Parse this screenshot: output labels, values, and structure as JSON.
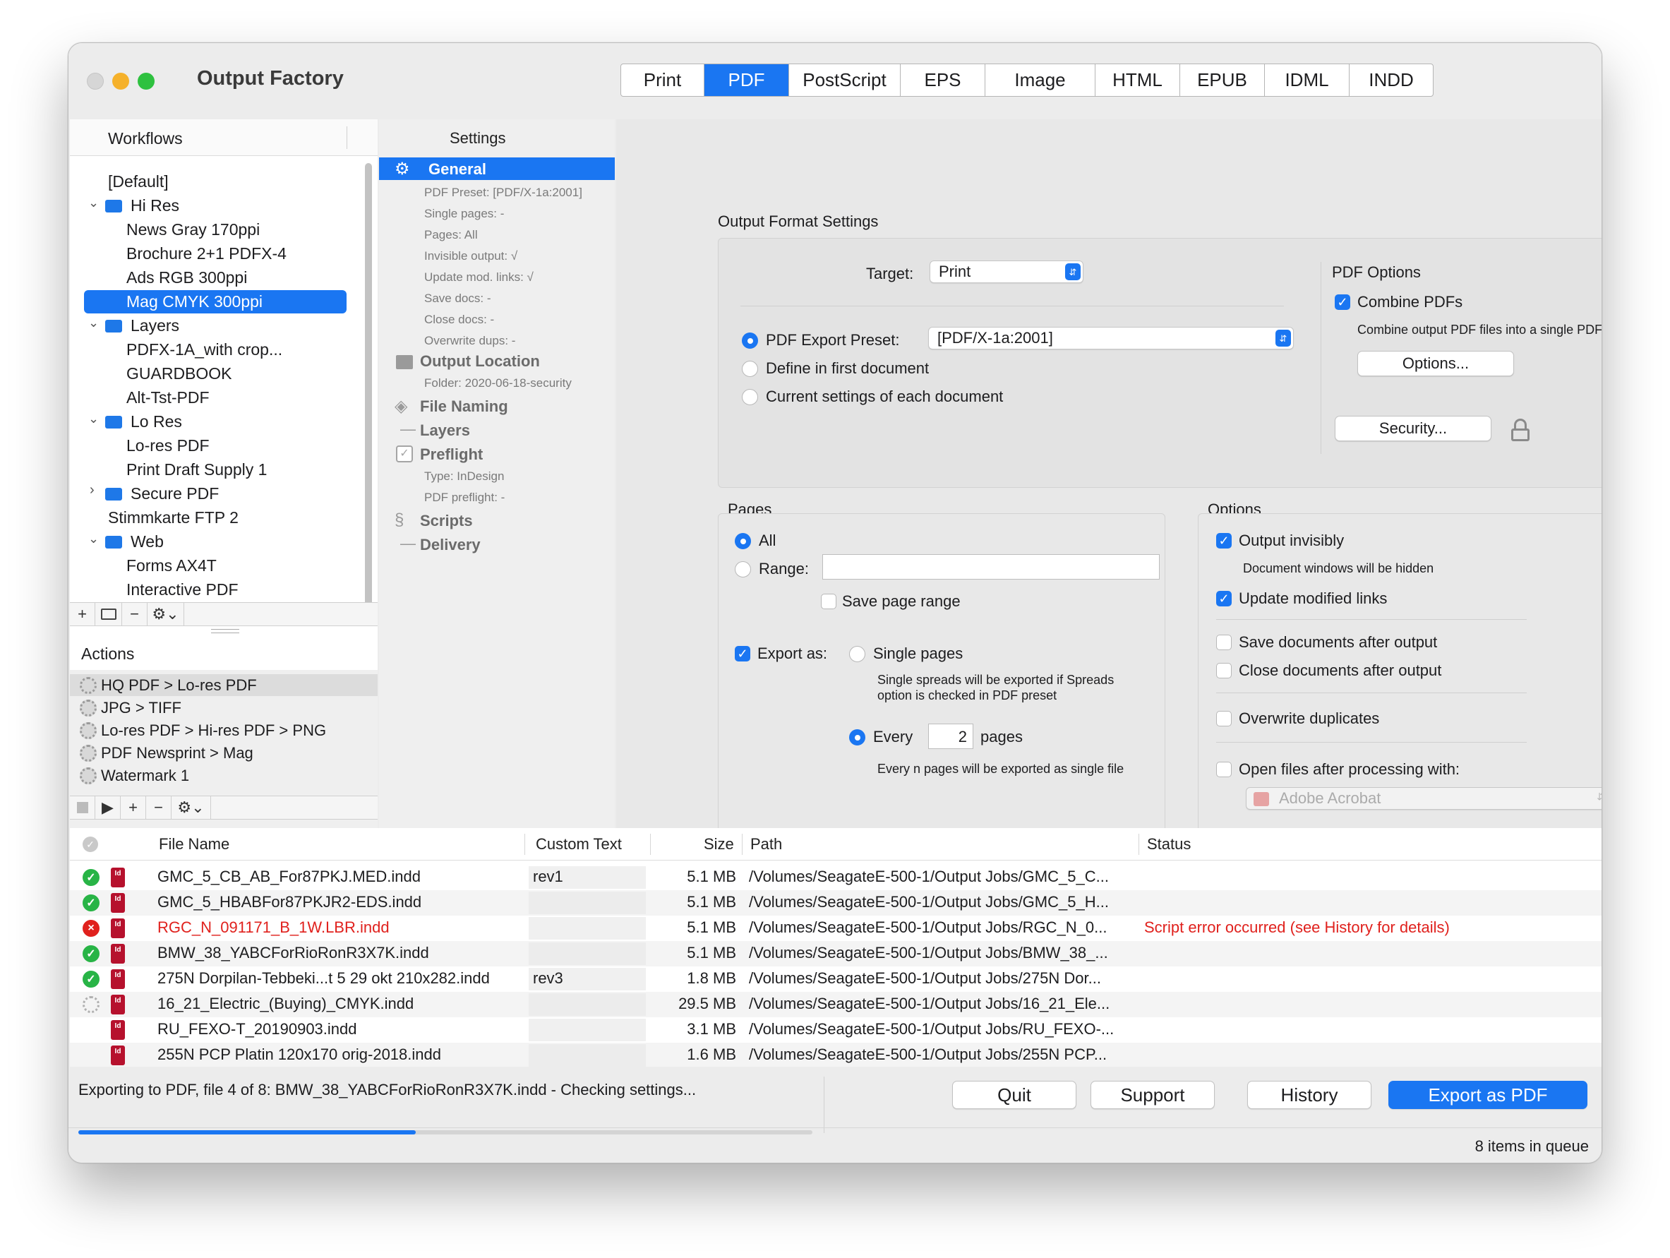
{
  "window": {
    "title": "Output Factory"
  },
  "format_tabs": [
    {
      "label": "Print",
      "active": false
    },
    {
      "label": "PDF",
      "active": true
    },
    {
      "label": "PostScript",
      "active": false
    },
    {
      "label": "EPS",
      "active": false
    },
    {
      "label": "Image",
      "active": false
    },
    {
      "label": "HTML",
      "active": false
    },
    {
      "label": "EPUB",
      "active": false
    },
    {
      "label": "IDML",
      "active": false
    },
    {
      "label": "INDD",
      "active": false
    }
  ],
  "workflows": {
    "header": "Workflows",
    "items": [
      {
        "label": "[Default]",
        "type": "item"
      },
      {
        "label": "Hi Res",
        "type": "folder",
        "expanded": true
      },
      {
        "label": "News Gray 170ppi",
        "type": "item"
      },
      {
        "label": "Brochure 2+1 PDFX-4",
        "type": "item"
      },
      {
        "label": "Ads RGB 300ppi",
        "type": "item"
      },
      {
        "label": "Mag CMYK 300ppi",
        "type": "item",
        "selected": true
      },
      {
        "label": "Layers",
        "type": "folder",
        "expanded": true
      },
      {
        "label": "PDFX-1A_with crop...",
        "type": "item"
      },
      {
        "label": "GUARDBOOK",
        "type": "item"
      },
      {
        "label": "Alt-Tst-PDF",
        "type": "item"
      },
      {
        "label": "Lo Res",
        "type": "folder",
        "expanded": true
      },
      {
        "label": "Lo-res PDF",
        "type": "item"
      },
      {
        "label": "Print Draft Supply 1",
        "type": "item"
      },
      {
        "label": "Secure PDF",
        "type": "folder",
        "expanded": false
      },
      {
        "label": "Stimmkarte FTP 2",
        "type": "item"
      },
      {
        "label": "Web",
        "type": "folder",
        "expanded": true
      },
      {
        "label": "Forms AX4T",
        "type": "item"
      },
      {
        "label": "Interactive PDF",
        "type": "item"
      }
    ],
    "toolbar": {
      "add": "+",
      "remove": "−"
    }
  },
  "actions": {
    "header": "Actions",
    "items": [
      "HQ PDF > Lo-res PDF",
      "JPG > TIFF",
      "Lo-res PDF > Hi-res PDF > PNG",
      "PDF Newsprint > Mag",
      "Watermark 1"
    ],
    "toolbar": {
      "add": "+",
      "remove": "−"
    }
  },
  "settings": {
    "header": "Settings",
    "general": "General",
    "general_subs": [
      "PDF Preset: [PDF/X-1a:2001]",
      "Single pages: -",
      "Pages: All",
      "Invisible output: √",
      "Update mod. links: √",
      "Save docs: -",
      "Close docs: -",
      "Overwrite dups: -"
    ],
    "output_location": "Output Location",
    "output_location_sub": "Folder: 2020-06-18-security",
    "file_naming": "File Naming",
    "layers": "Layers",
    "preflight": "Preflight",
    "preflight_subs": [
      "Type: InDesign",
      "PDF preflight: -"
    ],
    "scripts": "Scripts",
    "delivery": "Delivery",
    "dash": "—"
  },
  "output_format": {
    "title": "Output Format Settings",
    "target_label": "Target:",
    "target_value": "Print",
    "preset_label": "PDF Export Preset:",
    "preset_value": "[PDF/X-1a:2001]",
    "define_first": "Define in first document",
    "current_settings": "Current settings of each document",
    "pdf_options_title": "PDF Options",
    "combine_label": "Combine PDFs",
    "combine_desc": "Combine output PDF files into a single PDF.",
    "options_button": "Options...",
    "security_button": "Security..."
  },
  "pages": {
    "title": "Pages",
    "all": "All",
    "range": "Range:",
    "range_value": "",
    "save_range": "Save page range",
    "export_as": "Export as:",
    "single_pages": "Single pages",
    "single_desc_1": "Single spreads will be exported if Spreads",
    "single_desc_2": "option is checked in PDF preset",
    "every": "Every",
    "every_value": "2",
    "pages_word": "pages",
    "every_desc": "Every n pages will be exported as single file"
  },
  "options": {
    "title": "Options",
    "output_invisibly": "Output invisibly",
    "output_invisibly_desc": "Document windows will be hidden",
    "update_links": "Update modified links",
    "save_docs": "Save documents after output",
    "close_docs": "Close documents after output",
    "overwrite": "Overwrite duplicates",
    "open_files": "Open files after processing with:",
    "open_app": "Adobe Acrobat"
  },
  "queue": {
    "columns": {
      "file_name": "File Name",
      "custom_text": "Custom Text",
      "size": "Size",
      "path": "Path",
      "status": "Status"
    },
    "rows": [
      {
        "status": "ok",
        "name": "GMC_5_CB_AB_For87PKJ.MED.indd",
        "custom": "rev1",
        "size": "5.1 MB",
        "path": "/Volumes/SeagateE-500-1/Output Jobs/GMC_5_C...",
        "status_text": ""
      },
      {
        "status": "ok",
        "name": "GMC_5_HBABFor87PKJR2-EDS.indd",
        "custom": "",
        "size": "5.1 MB",
        "path": "/Volumes/SeagateE-500-1/Output Jobs/GMC_5_H...",
        "status_text": ""
      },
      {
        "status": "error",
        "name": "RGC_N_091171_B_1W.LBR.indd",
        "custom": "",
        "size": "5.1 MB",
        "path": "/Volumes/SeagateE-500-1/Output Jobs/RGC_N_0...",
        "status_text": "Script error occurred (see History for details)"
      },
      {
        "status": "ok",
        "name": "BMW_38_YABCForRioRonR3X7K.indd",
        "custom": "",
        "size": "5.1 MB",
        "path": "/Volumes/SeagateE-500-1/Output Jobs/BMW_38_...",
        "status_text": ""
      },
      {
        "status": "ok",
        "name": "275N Dorpilan-Tebbeki...t 5 29 okt 210x282.indd",
        "custom": "rev3",
        "size": "1.8 MB",
        "path": "/Volumes/SeagateE-500-1/Output Jobs/275N Dor...",
        "status_text": ""
      },
      {
        "status": "processing",
        "name": "16_21_Electric_(Buying)_CMYK.indd",
        "custom": "",
        "size": "29.5 MB",
        "path": "/Volumes/SeagateE-500-1/Output Jobs/16_21_Ele...",
        "status_text": ""
      },
      {
        "status": "pending",
        "name": "RU_FEXO-T_20190903.indd",
        "custom": "",
        "size": "3.1 MB",
        "path": "/Volumes/SeagateE-500-1/Output Jobs/RU_FEXO-...",
        "status_text": ""
      },
      {
        "status": "pending",
        "name": "255N PCP Platin 120x170 orig-2018.indd",
        "custom": "",
        "size": "1.6 MB",
        "path": "/Volumes/SeagateE-500-1/Output Jobs/255N PCP...",
        "status_text": ""
      }
    ]
  },
  "footer": {
    "status_text": "Exporting to PDF, file 4 of 8: BMW_38_YABCForRioRonR3X7K.indd - Checking settings...",
    "progress_fraction": 0.46,
    "quit": "Quit",
    "support": "Support",
    "history": "History",
    "export": "Export as PDF",
    "queue_count": "8 items in queue"
  },
  "colors": {
    "accent": "#1a76f2",
    "error": "#e0211d",
    "ok": "#28b446",
    "file_icon": "#b6112d"
  }
}
